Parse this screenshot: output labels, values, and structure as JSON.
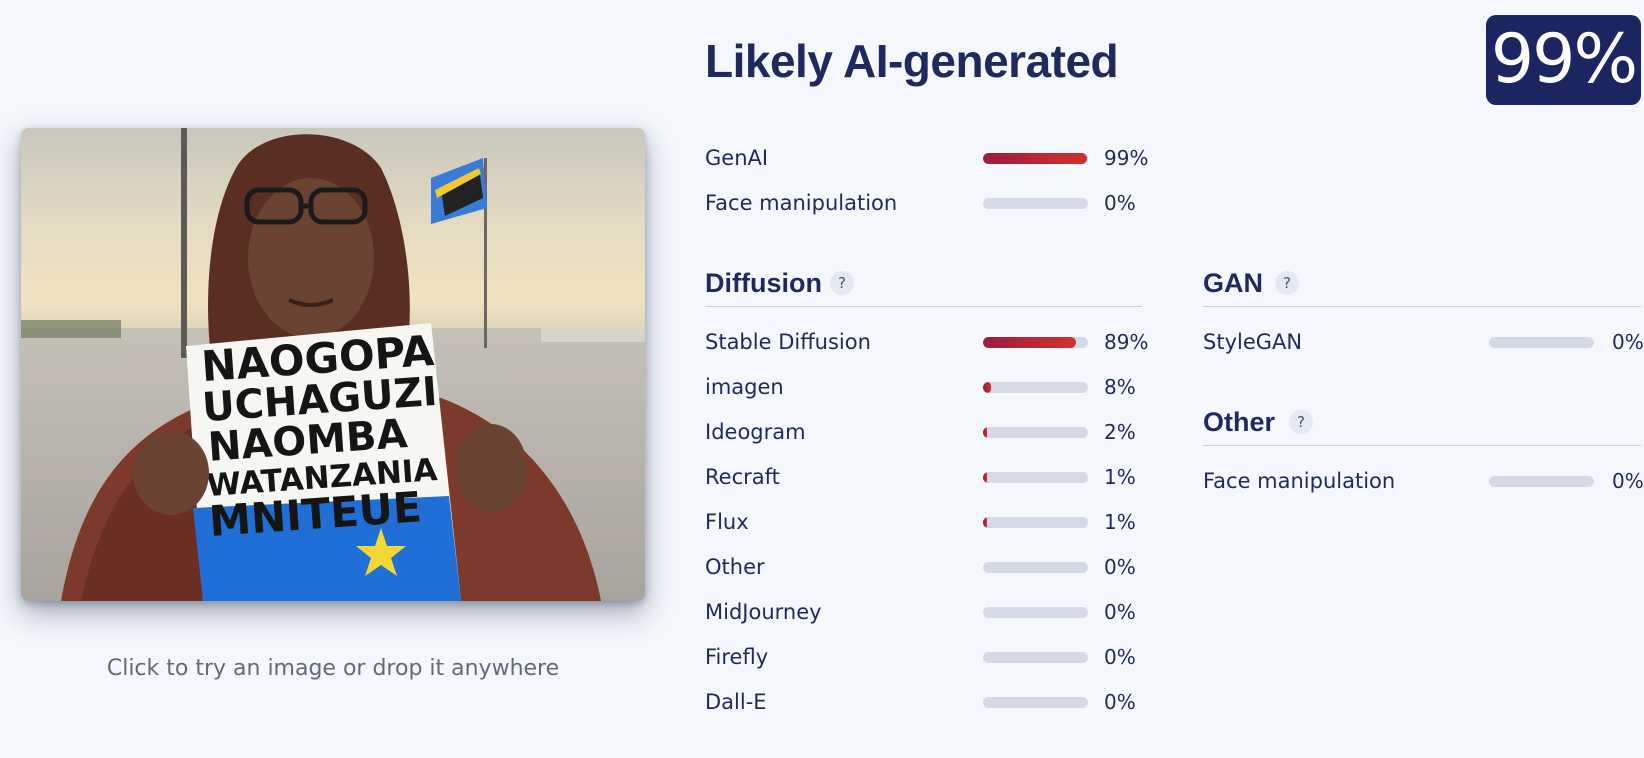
{
  "upload": {
    "caption": "Click to try an image or drop it anywhere",
    "sign_lines": [
      "NAOGOPA",
      "UCHAGUZI",
      "NAOMBA",
      "WATANZANIA",
      "MNITEUE"
    ]
  },
  "result": {
    "verdict": "Likely AI-generated",
    "score": "99%"
  },
  "overall": [
    {
      "label": "GenAI",
      "percent": "99%",
      "value": 0.99
    },
    {
      "label": "Face manipulation",
      "percent": "0%",
      "value": 0.0
    }
  ],
  "diffusion": {
    "title": "Diffusion",
    "help": "?",
    "items": [
      {
        "label": "Stable Diffusion",
        "percent": "89%",
        "value": 0.89
      },
      {
        "label": "imagen",
        "percent": "8%",
        "value": 0.08
      },
      {
        "label": "Ideogram",
        "percent": "2%",
        "value": 0.02
      },
      {
        "label": "Recraft",
        "percent": "1%",
        "value": 0.01
      },
      {
        "label": "Flux",
        "percent": "1%",
        "value": 0.01
      },
      {
        "label": "Other",
        "percent": "0%",
        "value": 0.0
      },
      {
        "label": "MidJourney",
        "percent": "0%",
        "value": 0.0
      },
      {
        "label": "Firefly",
        "percent": "0%",
        "value": 0.0
      },
      {
        "label": "Dall-E",
        "percent": "0%",
        "value": 0.0
      }
    ]
  },
  "gan": {
    "title": "GAN",
    "help": "?",
    "items": [
      {
        "label": "StyleGAN",
        "percent": "0%",
        "value": 0.0
      }
    ]
  },
  "other": {
    "title": "Other",
    "help": "?",
    "items": [
      {
        "label": "Face manipulation",
        "percent": "0%",
        "value": 0.0
      }
    ]
  },
  "colors": {
    "bar_start": "#9b1c3f",
    "bar_end": "#d2312b",
    "track": "#d3dae6",
    "badge": "#1b2660"
  }
}
